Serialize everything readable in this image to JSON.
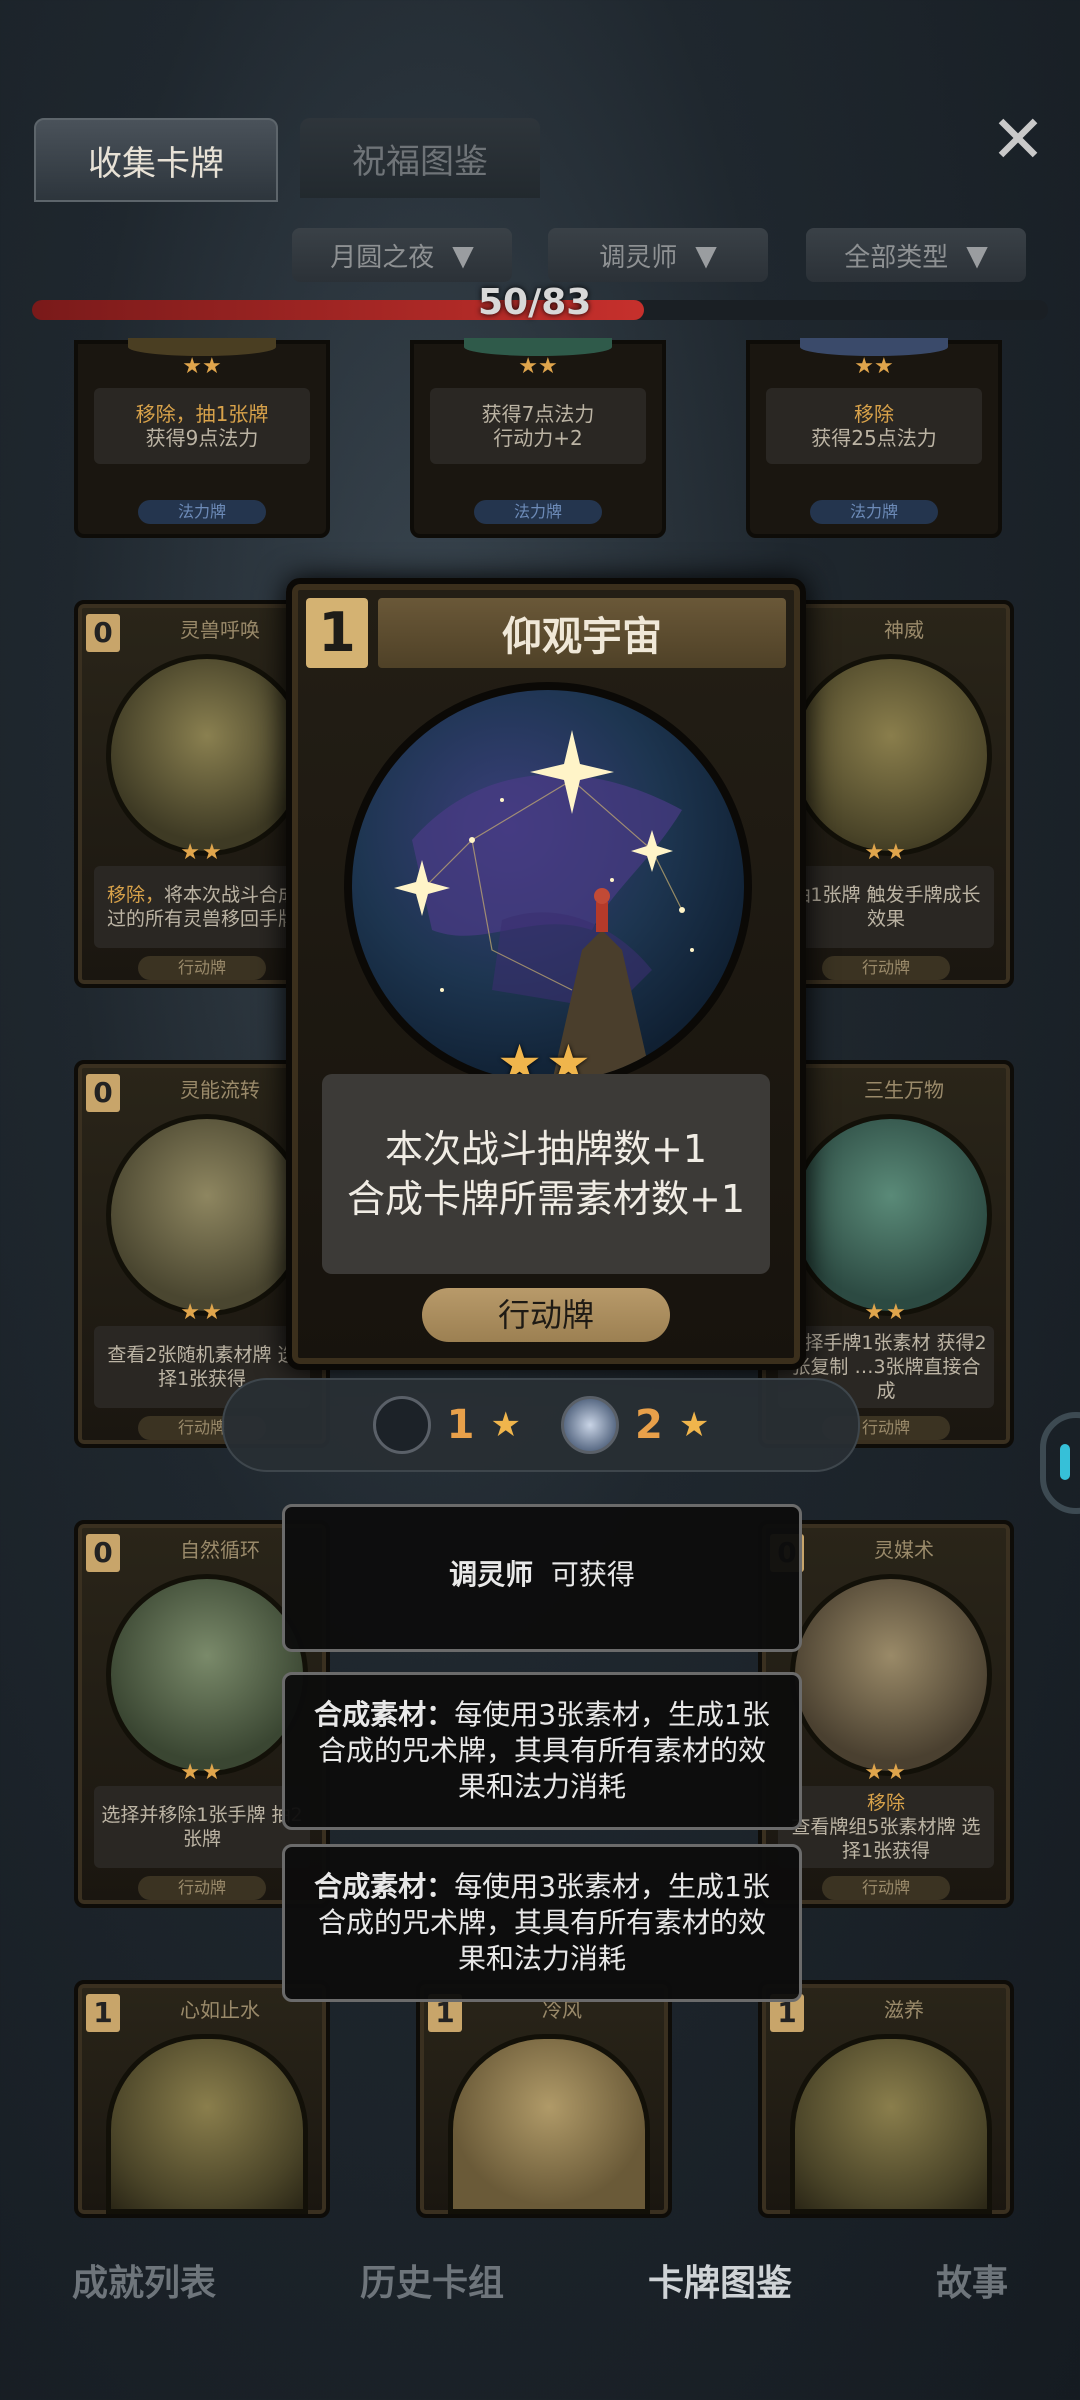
{
  "tabs": [
    {
      "label": "收集卡牌",
      "active": true
    },
    {
      "label": "祝福图鉴",
      "active": false
    }
  ],
  "close_icon": "close-x-icon",
  "filters": [
    "月圆之夜",
    "调灵师",
    "全部类型"
  ],
  "collection": {
    "text": "50/83",
    "collected": 50,
    "total": 83
  },
  "top_row": [
    {
      "desc_hl": "移除，抽1张牌",
      "desc": "获得9点法力",
      "type": "法力牌",
      "stars": "★★"
    },
    {
      "desc_hl": "",
      "desc": "获得7点法力\n行动力+2",
      "type": "法力牌",
      "stars": "★★"
    },
    {
      "desc_hl": "移除",
      "desc": "获得25点法力",
      "type": "法力牌",
      "stars": "★★"
    }
  ],
  "row2": [
    {
      "cost": "0",
      "name": "灵兽呼唤",
      "stars": "★★",
      "desc_hl": "移除，",
      "desc": "将本次战斗合成过的所有灵兽移回手牌",
      "type": "行动牌"
    },
    {
      "cost": "0",
      "name": "神威",
      "stars": "★★",
      "desc_hl": "",
      "desc": "抽1张牌 触发手牌成长效果",
      "type": "行动牌"
    }
  ],
  "row3": [
    {
      "cost": "0",
      "name": "灵能流转",
      "stars": "★★",
      "desc_hl": "",
      "desc": "查看2张随机素材牌 选择1张获得",
      "type": "行动牌"
    },
    {
      "cost": "0",
      "name": "三生万物",
      "stars": "★★",
      "desc_hl": "",
      "desc": "选择手牌1张素材 获得2张复制 …3张牌直接合成",
      "type": "行动牌"
    }
  ],
  "row4": [
    {
      "cost": "0",
      "name": "自然循环",
      "stars": "★★",
      "desc_hl": "",
      "desc": "选择并移除1张手牌 抽2张牌",
      "type": "行动牌"
    },
    {
      "cost": "0",
      "name": "灵媒术",
      "stars": "★★",
      "desc_hl": "移除",
      "desc": "查看牌组5张素材牌 选择1张获得",
      "type": "行动牌"
    }
  ],
  "row5": [
    {
      "cost": "1",
      "name": "心如止水"
    },
    {
      "cost": "1",
      "name": "冷风"
    },
    {
      "cost": "1",
      "name": "滋养"
    }
  ],
  "featured": {
    "cost": "1",
    "title": "仰观宇宙",
    "stars": "★★",
    "desc_line1": "本次战斗抽牌数+1",
    "desc_line2": "合成卡牌所需素材数+1",
    "type": "行动牌"
  },
  "levels": [
    {
      "level": "1",
      "selected": false
    },
    {
      "level": "2",
      "selected": true
    }
  ],
  "obtain_panel": {
    "class": "调灵师",
    "text": "可获得"
  },
  "keyword_panels": [
    {
      "term": "合成素材：",
      "text": "每使用3张素材，生成1张合成的咒术牌，其具有所有素材的效果和法力消耗"
    },
    {
      "term": "合成素材：",
      "text": "每使用3张素材，生成1张合成的咒术牌，其具有所有素材的效果和法力消耗"
    }
  ],
  "nav": [
    {
      "label": "成就列表",
      "active": false
    },
    {
      "label": "历史卡组",
      "active": false
    },
    {
      "label": "卡牌图鉴",
      "active": true
    },
    {
      "label": "故事",
      "active": false
    }
  ],
  "colors": {
    "accent_gold": "#e0a54c",
    "progress_red": "#c6302c",
    "mana_blue": "#24354e"
  }
}
